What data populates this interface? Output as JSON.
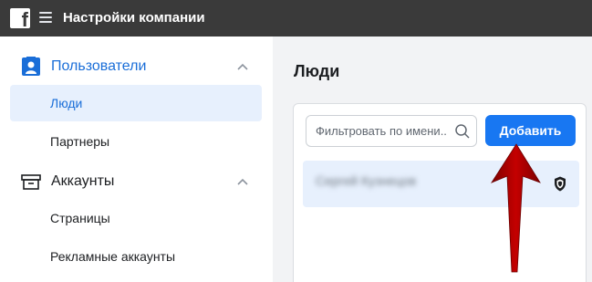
{
  "header": {
    "logo_icon": "facebook-logo-icon",
    "logo_text": "f",
    "menu_icon": "hamburger-menu-icon",
    "title": "Настройки компании",
    "bg_color": "#3a3a3a"
  },
  "sidebar": {
    "sections": [
      {
        "label": "Пользователи",
        "icon": "users-badge-icon",
        "expanded": true,
        "items": [
          {
            "label": "Люди",
            "active": true
          },
          {
            "label": "Партнеры",
            "active": false
          }
        ]
      },
      {
        "label": "Аккаунты",
        "icon": "archive-box-icon",
        "expanded": true,
        "items": [
          {
            "label": "Страницы",
            "active": false
          },
          {
            "label": "Рекламные аккаунты",
            "active": false
          }
        ]
      }
    ]
  },
  "main": {
    "title": "Люди",
    "search": {
      "placeholder": "Фильтровать по имени..."
    },
    "add_button": "Добавить",
    "people": [
      {
        "name": "Сергей Кузнецов",
        "blurred": true,
        "role_icon": "shield-icon"
      }
    ]
  },
  "annotation": {
    "arrow_color": "#b30000"
  },
  "colors": {
    "accent": "#1877f2",
    "active_bg": "#e7f0fd",
    "active_text": "#1a6ed8"
  }
}
